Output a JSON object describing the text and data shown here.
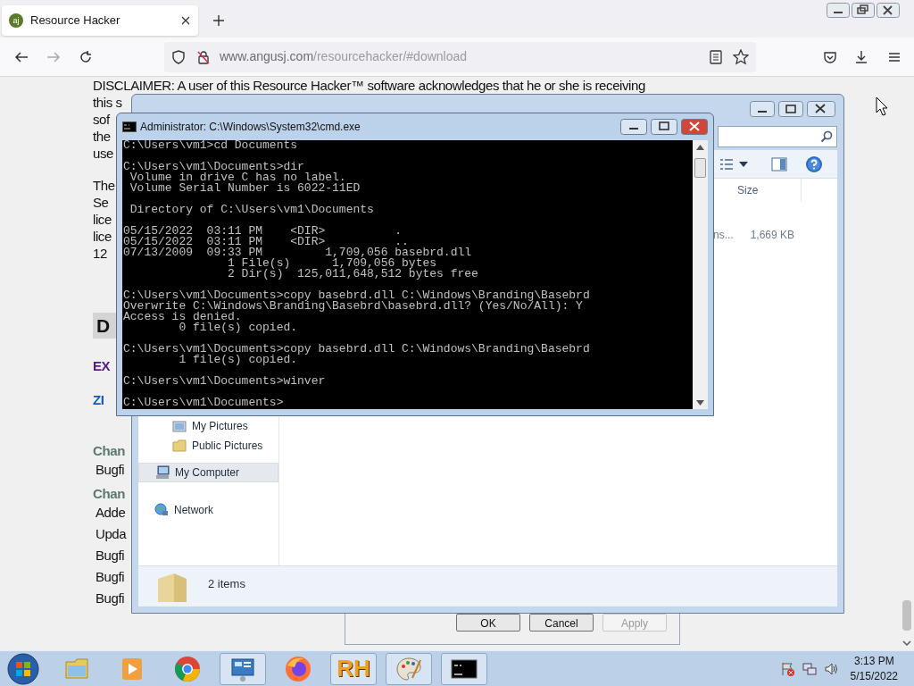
{
  "browser": {
    "tab": {
      "title": "Resource Hacker",
      "favicon": "aj"
    },
    "url": {
      "host": "www.angusj.com",
      "path": "/resourcehacker/#download"
    }
  },
  "page": {
    "paragraphs": [
      [
        "DISCLAIMER: A user of this Resource Hacker™ software acknowledges that he or she is receiving",
        "this s",
        "sof",
        "the",
        "use"
      ],
      [
        "The",
        "Se",
        "lice",
        "lice",
        "12"
      ]
    ],
    "heading": "D",
    "links": [
      {
        "text": "EX",
        "kind": "visited"
      },
      {
        "text": "ZI",
        "kind": "link"
      }
    ],
    "changes": [
      {
        "heading": "Chan",
        "items": [
          "Bugfi"
        ]
      },
      {
        "heading": "Chan",
        "items": [
          "Adde",
          "Upda",
          "Bugfi",
          "Bugfi",
          "Bugfi"
        ]
      }
    ]
  },
  "properties_dialog": {
    "buttons": [
      {
        "label": "OK",
        "disabled": false
      },
      {
        "label": "Cancel",
        "disabled": false
      },
      {
        "label": "Apply",
        "disabled": true
      }
    ]
  },
  "explorer": {
    "columns": [
      {
        "label": "Size"
      }
    ],
    "rows": [
      {
        "column_1": "ns...",
        "size": "1,669 KB"
      }
    ],
    "nav": [
      {
        "label": "My Pictures",
        "kind": "library",
        "selected": false
      },
      {
        "label": "Public Pictures",
        "kind": "folder",
        "selected": false
      },
      {
        "label": "My Computer",
        "kind": "computer",
        "selected": true
      },
      {
        "label": "Network",
        "kind": "network",
        "selected": false
      }
    ],
    "status": "2 items"
  },
  "cmd": {
    "title": "Administrator: C:\\Windows\\System32\\cmd.exe",
    "blocks": [
      [
        "C:\\Users\\vm1>cd Documents"
      ],
      [
        "C:\\Users\\vm1\\Documents>dir",
        " Volume in drive C has no label.",
        " Volume Serial Number is 6022-11ED"
      ],
      [
        " Directory of C:\\Users\\vm1\\Documents"
      ],
      [
        "05/15/2022  03:11 PM    <DIR>          .",
        "05/15/2022  03:11 PM    <DIR>          ..",
        "07/13/2009  09:33 PM         1,709,056 basebrd.dll",
        "               1 File(s)      1,709,056 bytes",
        "               2 Dir(s)  125,011,648,512 bytes free"
      ],
      [
        "C:\\Users\\vm1\\Documents>copy basebrd.dll C:\\Windows\\Branding\\Basebrd",
        "Overwrite C:\\Windows\\Branding\\Basebrd\\basebrd.dll? (Yes/No/All): Y",
        "Access is denied.",
        "        0 file(s) copied."
      ],
      [
        "C:\\Users\\vm1\\Documents>copy basebrd.dll C:\\Windows\\Branding\\Basebrd",
        "        1 file(s) copied."
      ],
      [
        "C:\\Users\\vm1\\Documents>winver"
      ],
      [
        "C:\\Users\\vm1\\Documents>"
      ]
    ]
  },
  "taskbar": {
    "apps": [
      {
        "kind": "explorer",
        "running": false
      },
      {
        "kind": "media",
        "running": false
      },
      {
        "kind": "chrome",
        "running": false
      },
      {
        "kind": "control-panel",
        "running": true
      },
      {
        "kind": "firefox",
        "running": false
      },
      {
        "kind": "logo",
        "text": "RH",
        "running": true
      },
      {
        "kind": "paint",
        "running": true
      },
      {
        "kind": "console",
        "running": true
      }
    ],
    "clock": {
      "time": "3:13 PM",
      "date": "5/15/2022"
    }
  }
}
